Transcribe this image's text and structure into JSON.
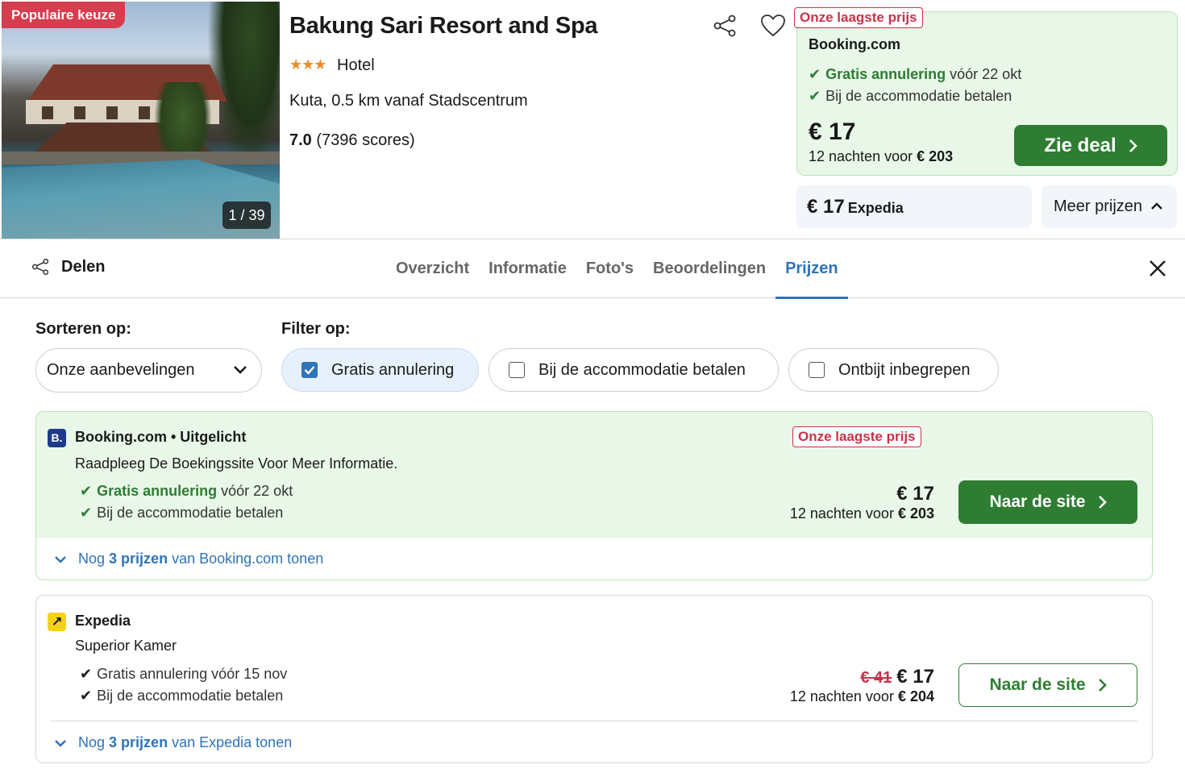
{
  "hotel": {
    "badge": "Populaire keuze",
    "photo_counter": "1 / 39",
    "name": "Bakung Sari Resort and Spa",
    "stars": "★★★",
    "type": "Hotel",
    "location": "Kuta, 0.5 km vanaf Stadscentrum",
    "score": "7.0",
    "score_count": "(7396 scores)"
  },
  "top_deal": {
    "lowest_label": "Onze laagste prijs",
    "provider": "Booking.com",
    "feature1_bold": "Gratis annulering",
    "feature1_rest": "vóór 22 okt",
    "feature2": "Bij de accommodatie betalen",
    "price": "€ 17",
    "nights_text": "12 nachten voor",
    "nights_total": "€ 203",
    "button": "Zie deal"
  },
  "alt_deal": {
    "price": "€ 17",
    "provider": "Expedia",
    "more_prices": "Meer prijzen"
  },
  "nav": {
    "share": "Delen",
    "tabs": [
      "Overzicht",
      "Informatie",
      "Foto's",
      "Beoordelingen",
      "Prijzen"
    ],
    "active_tab": "Prijzen"
  },
  "sort": {
    "label": "Sorteren op:",
    "selected": "Onze aanbevelingen"
  },
  "filter": {
    "label": "Filter op:",
    "options": [
      {
        "label": "Gratis annulering",
        "checked": true
      },
      {
        "label": "Bij de accommodatie betalen",
        "checked": false
      },
      {
        "label": "Ontbijt inbegrepen",
        "checked": false
      }
    ]
  },
  "offers": [
    {
      "provider": "Booking.com • Uitgelicht",
      "logo_text": "B.",
      "logo_color": "#1f3a8a",
      "lowest_label": "Onze laagste prijs",
      "room": "Raadpleeg De Boekingssite Voor Meer Informatie.",
      "feature1_bold": "Gratis annulering",
      "feature1_rest": "vóór 22 okt",
      "feature2": "Bij de accommodatie betalen",
      "price": "€ 17",
      "nights_text": "12 nachten voor",
      "nights_total": "€ 203",
      "button": "Naar de site",
      "more_prefix": "Nog",
      "more_count": "3 prijzen",
      "more_suffix": "van Booking.com tonen"
    },
    {
      "provider": "Expedia",
      "logo_text": "↗",
      "logo_color": "#f5d21a",
      "room": "Superior Kamer",
      "feature1": "Gratis annulering vóór 15 nov",
      "feature2": "Bij de accommodatie betalen",
      "old_price": "€ 41",
      "price": "€ 17",
      "nights_text": "12 nachten voor",
      "nights_total": "€ 204",
      "button": "Naar de site",
      "more_prefix": "Nog",
      "more_count": "3 prijzen",
      "more_suffix": "van Expedia tonen"
    }
  ],
  "colors": {
    "accent_blue": "#2f73b8",
    "deal_green": "#2e7d32",
    "lowest_red": "#c8324a",
    "badge_red": "#d63d4e",
    "star_orange": "#f08a24"
  }
}
